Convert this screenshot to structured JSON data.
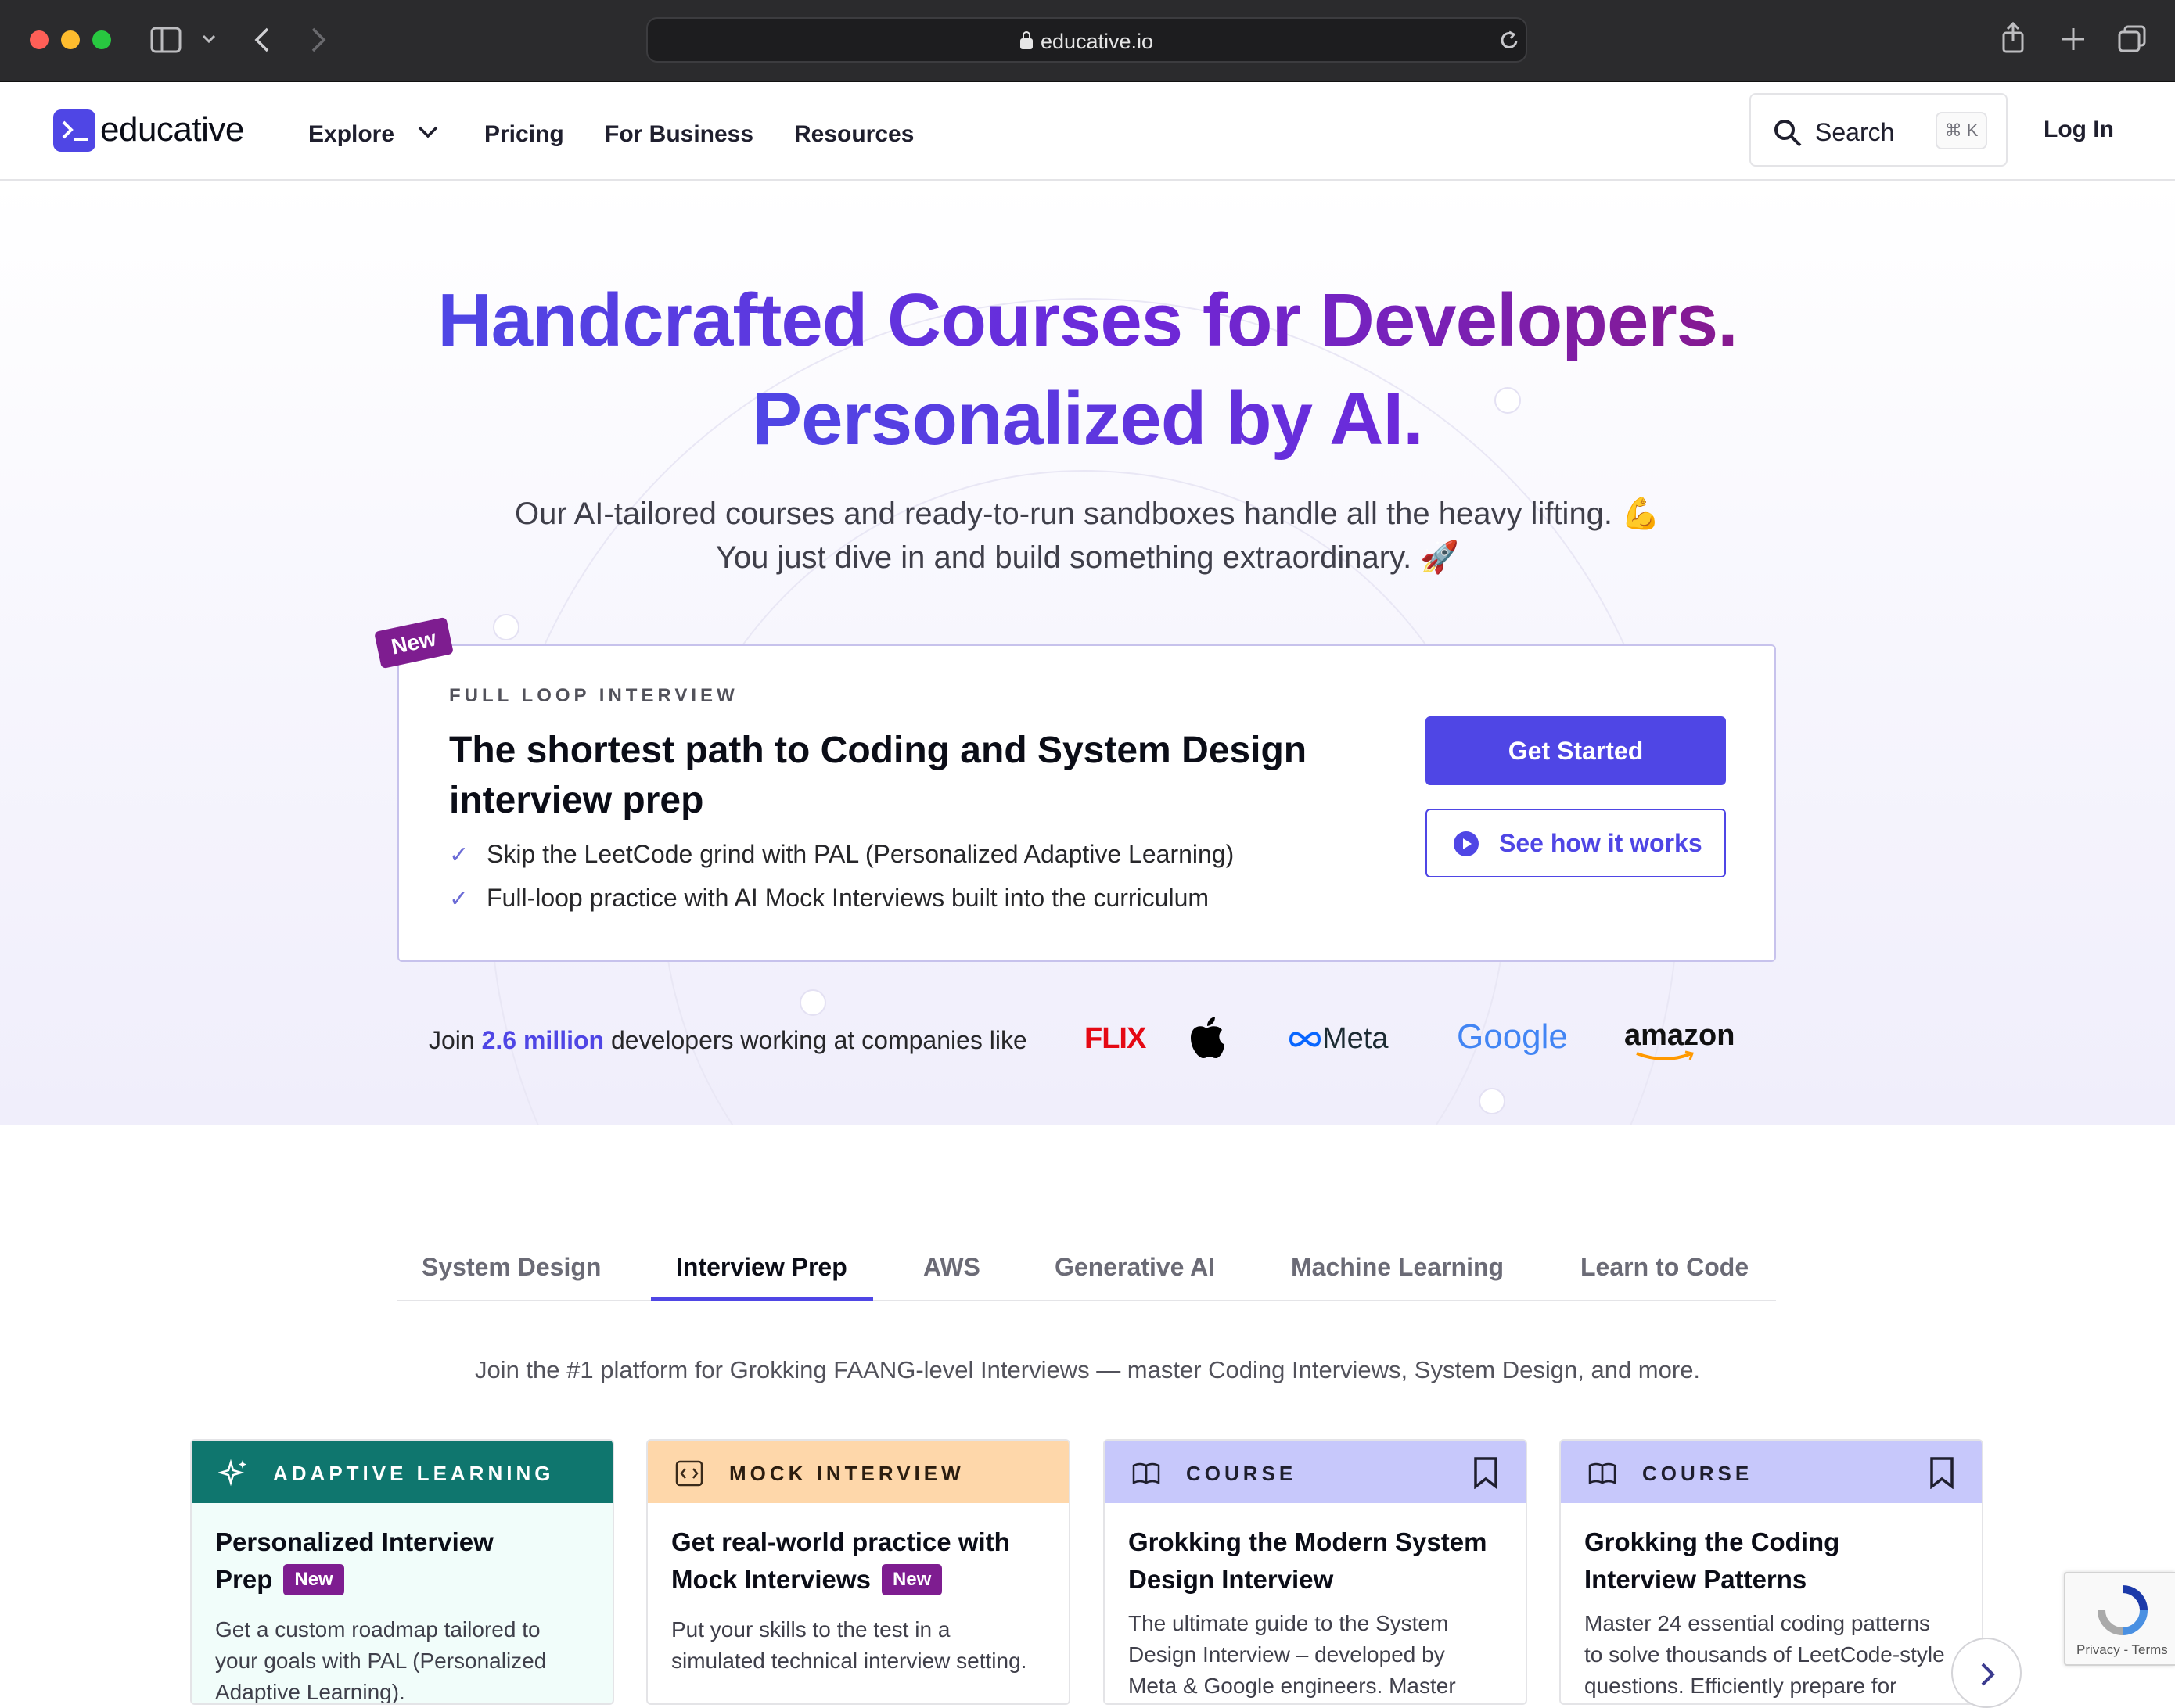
{
  "browser": {
    "url": "educative.io"
  },
  "header": {
    "logo_text": "educative",
    "nav": [
      "Explore",
      "Pricing",
      "For Business",
      "Resources"
    ],
    "search_label": "Search",
    "search_shortcut": "⌘ K",
    "login_label": "Log In"
  },
  "hero": {
    "title_line1": "Handcrafted Courses for Developers.",
    "title_line2": "Personalized by AI.",
    "subtitle_line1": "Our AI-tailored courses and ready-to-run sandboxes handle all the heavy lifting. 💪",
    "subtitle_line2": "You just dive in and build something extraordinary. 🚀"
  },
  "promo": {
    "tag": "New",
    "eyebrow": "FULL LOOP INTERVIEW",
    "title": "The shortest path to Coding and System Design interview prep",
    "points": [
      "Skip the LeetCode grind with PAL (Personalized Adaptive Learning)",
      "Full-loop practice with AI Mock Interviews built into the curriculum"
    ],
    "primary_button": "Get Started",
    "secondary_button": "See how it works"
  },
  "social_proof": {
    "prefix": "Join ",
    "highlight": "2.6 million",
    "suffix": " developers working at companies like",
    "companies": [
      "FLIX",
      "Apple",
      "Meta",
      "Google",
      "amazon"
    ],
    "netflix_text": "FLIX",
    "meta_text": "Meta",
    "google_text": "Google",
    "amazon_text": "amazon"
  },
  "tabs": {
    "items": [
      "System Design",
      "Interview Prep",
      "AWS",
      "Generative AI",
      "Machine Learning",
      "Learn to Code"
    ],
    "active_index": 1,
    "description": "Join the #1 platform for Grokking FAANG-level Interviews — master Coding Interviews, System Design, and more."
  },
  "cards": [
    {
      "kind": "ADAPTIVE LEARNING",
      "title": "Personalized Interview Prep",
      "badge": "New",
      "desc_line1": "Get a custom roadmap tailored to",
      "desc_line2": "your goals with PAL (Personalized",
      "desc_line3": "Adaptive Learning)."
    },
    {
      "kind": "MOCK INTERVIEW",
      "title": "Get real-world practice with Mock Interviews",
      "badge": "New",
      "desc_line1": "Put your skills to the test in a",
      "desc_line2": "simulated technical interview setting."
    },
    {
      "kind": "COURSE",
      "title": "Grokking the Modern System Design Interview",
      "desc_line1": "The ultimate guide to the System",
      "desc_line2": "Design Interview – developed by",
      "desc_line3": "Meta & Google engineers. Master"
    },
    {
      "kind": "COURSE",
      "title": "Grokking the Coding Interview Patterns",
      "desc_line1": "Master 24 essential coding patterns",
      "desc_line2": "to solve thousands of LeetCode-style",
      "desc_line3": "questions. Efficiently prepare for"
    }
  ],
  "recaptcha": {
    "text": "Privacy - Terms"
  },
  "colors": {
    "brand": "#4f46e5",
    "badge": "#7e1d90",
    "adaptive_head": "#0f766e",
    "mock_head": "#fed7aa",
    "course_head": "#c7c8fb"
  }
}
